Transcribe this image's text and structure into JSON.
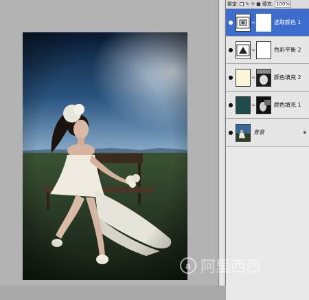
{
  "layers_panel": {
    "lock_label": "锁定:",
    "fill_label": "填充:",
    "fill_value": "100%",
    "layers": [
      {
        "name": "选取颜色 1",
        "selected": true,
        "thumb": "selective-color-adjustment-icon",
        "visible_icon": "eye-icon"
      },
      {
        "name": "色彩平衡 2",
        "selected": false,
        "thumb": "color-balance-adjustment-icon",
        "visible_icon": "eye-icon"
      },
      {
        "name": "颜色填充 2",
        "selected": false,
        "thumb_color": "#fbf6d9",
        "visible_icon": "eye-icon"
      },
      {
        "name": "颜色填充 1",
        "selected": false,
        "thumb_color": "#1f4c4a",
        "visible_icon": "eye-icon"
      },
      {
        "name": "背景",
        "selected": false,
        "thumb": "photo-thumbnail",
        "visible_icon": "eye-icon",
        "locked": true
      }
    ]
  },
  "watermark": {
    "text": "阿里西西",
    "letter": "a"
  },
  "colors": {
    "selected_layer": "#3d6ccf",
    "sky_top": "#0a1d38",
    "sky_bottom": "#7d9fc1",
    "grass": "#223522"
  }
}
